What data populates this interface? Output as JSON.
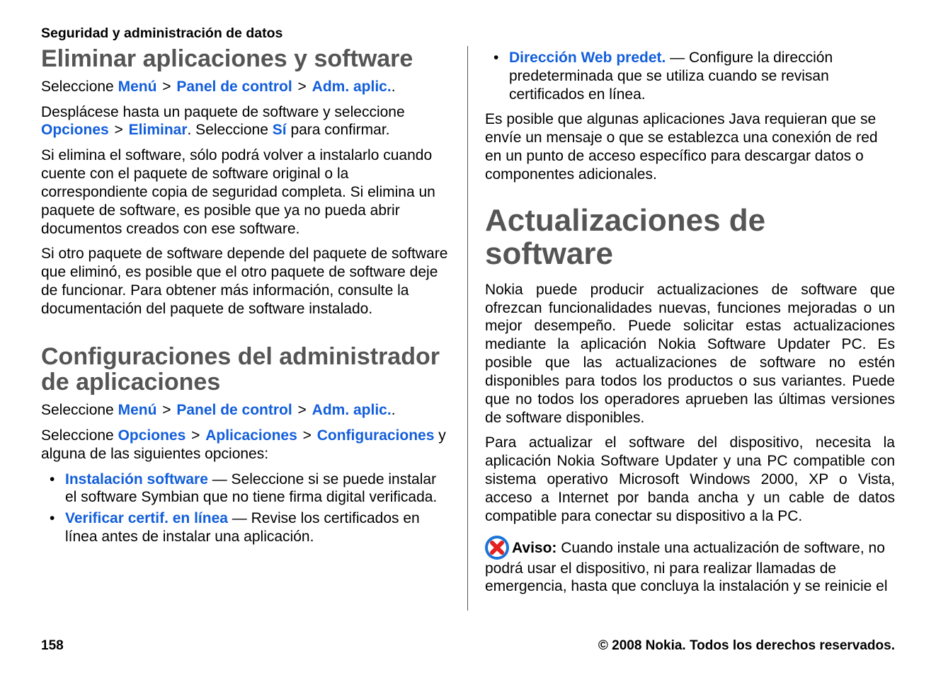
{
  "header": "Seguridad y administración de datos",
  "left": {
    "h2a": "Eliminar aplicaciones y software",
    "sel_0": "Seleccione ",
    "menu": "Menú",
    "panel": "Panel de control",
    "adm": "Adm. aplic.",
    "period": ".",
    "p1a": "Desplácese hasta un paquete de software y seleccione ",
    "opciones": "Opciones",
    "eliminar": "Eliminar",
    "p1b": ". Seleccione ",
    "si": "Sí",
    "p1c": " para confirmar.",
    "p2": "Si elimina el software, sólo podrá volver a instalarlo cuando cuente con el paquete de software original o la correspondiente copia de seguridad completa. Si elimina un paquete de software, es posible que ya no pueda abrir documentos creados con ese software.",
    "p3": "Si otro paquete de software depende del paquete de software que eliminó, es posible que el otro paquete de software deje de funcionar. Para obtener más información, consulte la documentación del paquete de software instalado.",
    "h2b": "Configuraciones del administrador de aplicaciones",
    "sel_1": "Seleccione ",
    "p2a": "Seleccione ",
    "aplicaciones": "Aplicaciones",
    "config": "Configuraciones",
    "p2b": " y alguna de las siguientes opciones:",
    "bullets": [
      {
        "b": "Instalación software",
        "t": " — Seleccione si se puede instalar el software Symbian que no tiene firma digital verificada."
      },
      {
        "b": "Verificar certif. en línea",
        "t": " — Revise los certificados en línea antes de instalar una aplicación."
      }
    ]
  },
  "right": {
    "bullet0b": "Dirección Web predet.",
    "bullet0t": " — Configure la dirección predeterminada que se utiliza cuando se revisan certificados en línea.",
    "p1": "Es posible que algunas aplicaciones Java requieran que se envíe un mensaje o que se establezca una conexión de red en un punto de acceso específico para descargar datos o componentes adicionales.",
    "h1": "Actualizaciones de software",
    "p2": "Nokia puede producir actualizaciones de software que ofrezcan funcionalidades nuevas, funciones mejoradas o un mejor desempeño. Puede solicitar estas actualizaciones mediante la aplicación Nokia Software Updater PC. Es posible que las actualizaciones de software no estén disponibles para todos los productos o sus variantes. Puede que no todos los operadores aprueben las últimas versiones de software disponibles.",
    "p3": "Para actualizar el software del dispositivo, necesita la aplicación Nokia Software Updater y una PC compatible con sistema operativo Microsoft Windows 2000, XP o Vista, acceso a Internet por banda ancha y un cable de datos compatible para conectar su dispositivo a la PC.",
    "aviso_label": "Aviso:",
    "aviso_text": " Cuando instale una actualización de software, no podrá usar el dispositivo, ni para realizar llamadas de emergencia, hasta que concluya la instalación y se reinicie el"
  },
  "footer": {
    "page": "158",
    "copy": "© 2008 Nokia. Todos los derechos reservados."
  }
}
